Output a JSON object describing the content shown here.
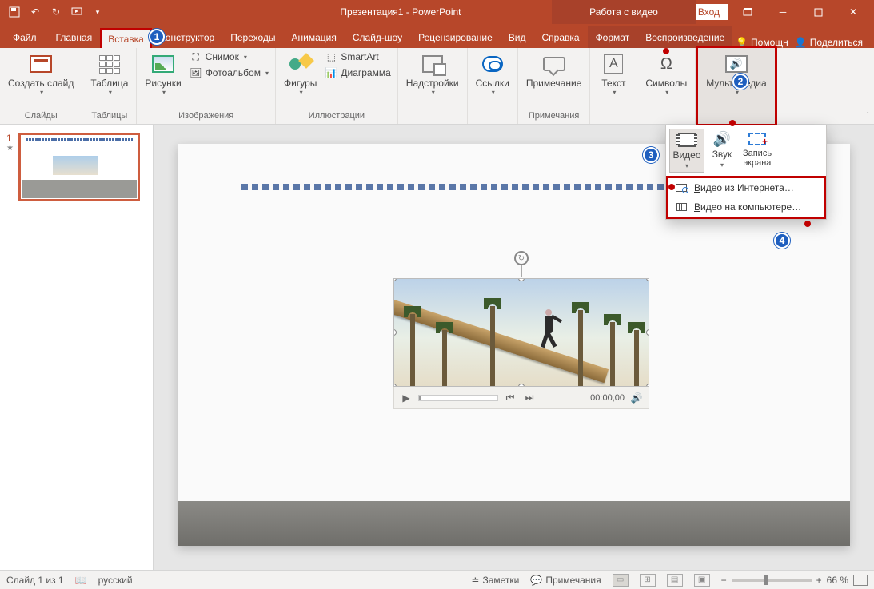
{
  "app": {
    "title": "Презентация1 - PowerPoint",
    "contextual_tab_title": "Работа с видео",
    "signin": "Вход"
  },
  "qat": {
    "save": "save",
    "undo": "undo",
    "redo": "redo",
    "start": "start-from-beginning"
  },
  "tabs": {
    "file": "Файл",
    "home": "Главная",
    "insert": "Вставка",
    "design": "Конструктор",
    "transitions": "Переходы",
    "animations": "Анимация",
    "slideshow": "Слайд-шоу",
    "review": "Рецензирование",
    "view": "Вид",
    "help": "Справка",
    "format": "Формат",
    "playback": "Воспроизведение",
    "tell_me": "Помощн",
    "share": "Поделиться"
  },
  "ribbon": {
    "slides": {
      "new_slide": "Создать слайд",
      "group": "Слайды"
    },
    "tables": {
      "table": "Таблица",
      "group": "Таблицы"
    },
    "images": {
      "pictures": "Рисунки",
      "screenshot": "Снимок",
      "photo_album": "Фотоальбом",
      "group": "Изображения"
    },
    "illustrations": {
      "shapes": "Фигуры",
      "smartart": "SmartArt",
      "chart": "Диаграмма",
      "group": "Иллюстрации"
    },
    "addins": {
      "addins": "Надстройки"
    },
    "links": {
      "links": "Ссылки"
    },
    "comments": {
      "comment": "Примечание",
      "group": "Примечания"
    },
    "text": {
      "text": "Текст"
    },
    "symbols": {
      "symbols": "Символы"
    },
    "media": {
      "media": "Мультимедиа"
    }
  },
  "media_panel": {
    "video": "Видео",
    "audio": "Звук",
    "screen_rec": "Запись экрана",
    "menu_online": "Видео из Интернета…",
    "menu_online_u": "В",
    "menu_file": "Видео на компьютере…",
    "menu_file_u": "В"
  },
  "player": {
    "time": "00:00,00"
  },
  "status": {
    "slide": "Слайд 1 из 1",
    "lang": "русский",
    "notes": "Заметки",
    "comments": "Примечания",
    "zoom_pct": "66 %"
  },
  "callouts": {
    "c1": "1",
    "c2": "2",
    "c3": "3",
    "c4": "4"
  }
}
